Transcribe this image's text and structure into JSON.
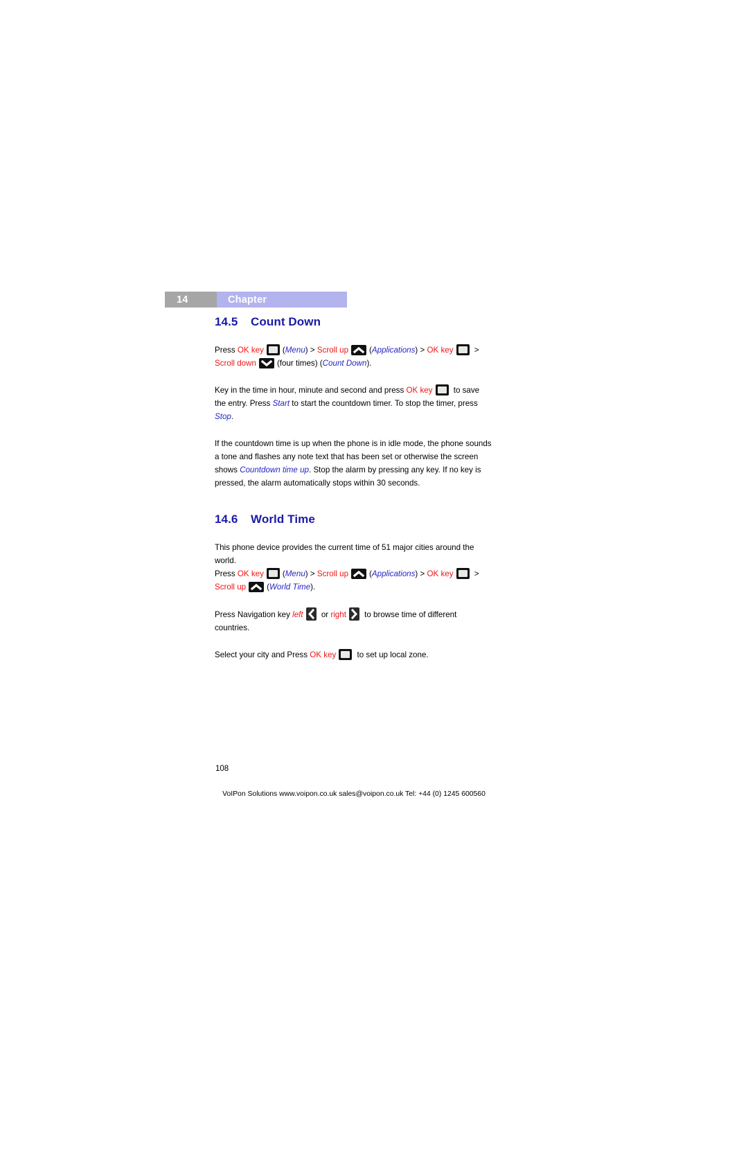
{
  "document": {
    "chapter": {
      "number": "14",
      "label": "Chapter"
    },
    "page_number": "108",
    "footer": "VoIPon Solutions  www.voipon.co.uk  sales@voipon.co.uk  Tel: +44 (0) 1245 600560"
  },
  "colors": {
    "heading_blue": "#1a1aa8",
    "key_red": "#f01414",
    "menu_blue": "#2424c8",
    "chapter_number_bg": "#a6a6a6",
    "chapter_label_bg": "#b3b3ee"
  },
  "sections": [
    {
      "number": "14.5",
      "title": "Count Down",
      "nav_path": {
        "press_label": "Press",
        "ok_key_label": "OK key",
        "menu_label_open": "(",
        "menu_label": "Menu",
        "menu_label_close": ")",
        "gt1": ">",
        "scroll_up_label": "Scroll up",
        "applications_open": "(",
        "applications_label": "Applications",
        "applications_close": ")",
        "gt2": ">",
        "ok_key_label2": "OK key",
        "gt3": ">",
        "scroll_down_label": "Scroll down",
        "four_times_label": "(four times)",
        "count_down_open": "(",
        "count_down_label": "Count Down",
        "count_down_close": ")."
      },
      "paragraph_2": {
        "part1": "Key in the time in hour, minute and second and press ",
        "ok_key_label": "OK key",
        "part2": " to save the entry. Press ",
        "start_label": "Start",
        "part3": " to start the countdown timer. To stop the timer, press ",
        "stop_label": "Stop",
        "part4": "."
      },
      "paragraph_3": {
        "part1": "If the countdown time is up when the phone is in idle mode, the phone sounds a tone and flashes any note text that has been set or otherwise the screen shows ",
        "countdown_time_up_label": "Countdown time up",
        "part2": ". Stop the alarm by pressing any key. If no key is pressed, the alarm automatically stops within 30 seconds."
      }
    },
    {
      "number": "14.6",
      "title": "World Time",
      "intro": "This phone device provides the current time of 51 major cities around the world.",
      "nav_path": {
        "press_label": "Press",
        "ok_key_label": "OK key",
        "menu_label_open": "(",
        "menu_label": "Menu",
        "menu_label_close": ")",
        "gt1": ">",
        "scroll_up_label": "Scroll up",
        "applications_open": "(",
        "applications_label": "Applications",
        "applications_close": ")",
        "gt2": ">",
        "ok_key_label2": "OK key",
        "gt3": ">",
        "scroll_up_label2": "Scroll up",
        "world_time_open": "(",
        "world_time_label": "World Time",
        "world_time_close": ")."
      },
      "paragraph_nav": {
        "part1": "Press Navigation key ",
        "left_label": "left",
        "or_label": " or ",
        "right_label": "right",
        "part2": " to browse time of different countries."
      },
      "paragraph_select": {
        "part1": "Select your city and Press ",
        "ok_key_label": "OK key",
        "part2": " to set up local zone."
      }
    }
  ],
  "icons": {
    "ok_key": "ok-key-icon",
    "scroll_up": "scroll-up-arrow-icon",
    "scroll_down": "scroll-down-arrow-icon",
    "nav_left": "nav-left-arrow-icon",
    "nav_right": "nav-right-arrow-icon"
  }
}
